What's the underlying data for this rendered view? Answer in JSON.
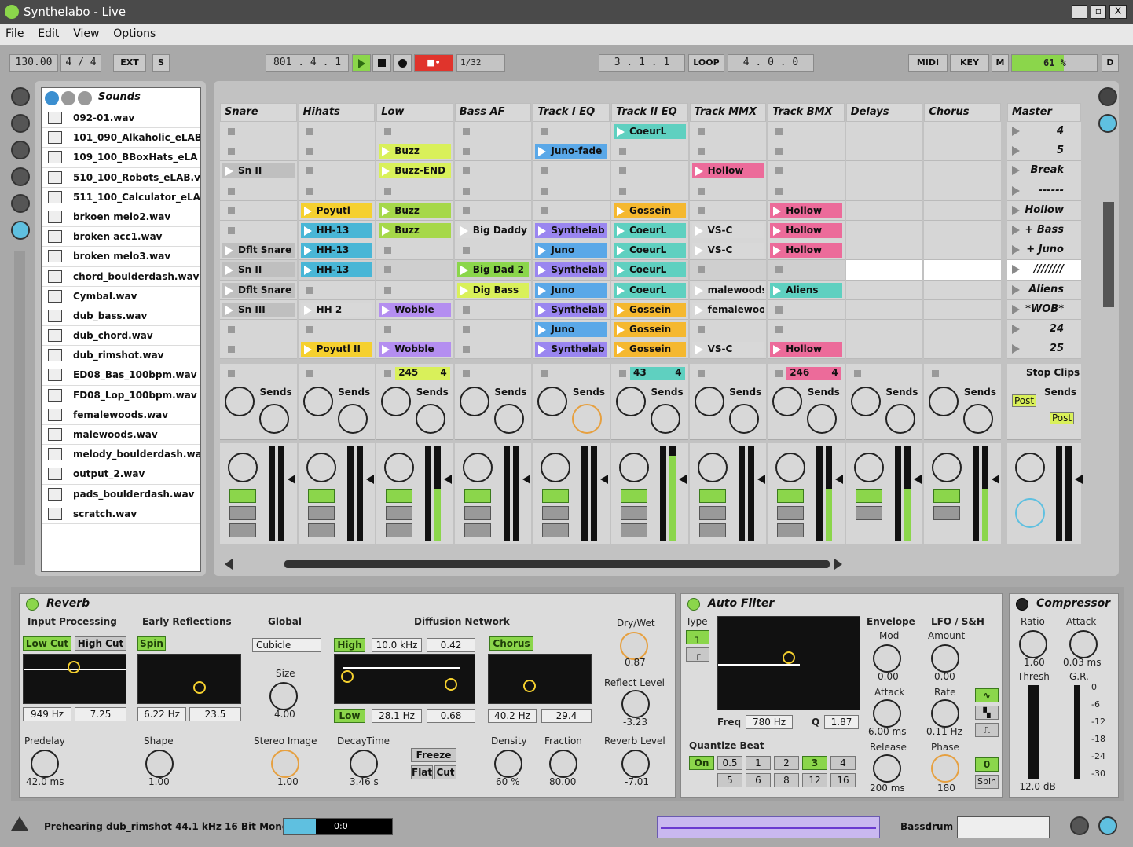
{
  "app": {
    "title": "Synthelabo - Live",
    "window_controls": [
      "_",
      "▫",
      "X"
    ]
  },
  "menu": [
    "File",
    "Edit",
    "View",
    "Options"
  ],
  "transport": {
    "tempo": "130.00",
    "signature": "4 / 4",
    "ext": "EXT",
    "s": "S",
    "position": "801 .  4 .  1",
    "quantize": "1/32",
    "loop_start": "3 .  1 .  1",
    "loop": "LOOP",
    "loop_length": "4 .  0 .  0",
    "midi": "MIDI",
    "key": "KEY",
    "m": "M",
    "cpu": "61 %",
    "d": "D"
  },
  "browser": {
    "tab": "Sounds",
    "files": [
      "092-01.wav",
      "101_090_Alkaholic_eLAB",
      "109_100_BBoxHats_eLA",
      "510_100_Robots_eLAB.v",
      "511_100_Calculator_eLA",
      "brkoen melo2.wav",
      "broken acc1.wav",
      "broken melo3.wav",
      "chord_boulderdash.wav",
      "Cymbal.wav",
      "dub_bass.wav",
      "dub_chord.wav",
      "dub_rimshot.wav",
      "ED08_Bas_100bpm.wav",
      "FD08_Lop_100bpm.wav",
      "femalewoods.wav",
      "malewoods.wav",
      "melody_boulderdash.wa",
      "output_2.wav",
      "pads_boulderdash.wav",
      "scratch.wav"
    ]
  },
  "tracks": [
    {
      "name": "Snare",
      "clips": [
        "",
        "",
        "Sn II",
        "",
        "",
        "",
        "Dflt Snare",
        "Sn II",
        "Dflt Snare",
        "Sn III",
        "",
        ""
      ],
      "colors": [
        "",
        "",
        "#bfbfbf",
        "",
        "",
        "",
        "#bfbfbf",
        "#bfbfbf",
        "#bfbfbf",
        "#bfbfbf",
        "",
        ""
      ]
    },
    {
      "name": "Hihats",
      "clips": [
        "",
        "",
        "",
        "",
        "Poyutl",
        "HH-13",
        "HH-13",
        "HH-13",
        "",
        "HH 2",
        "",
        "Poyutl II"
      ],
      "colors": [
        "",
        "",
        "",
        "",
        "#f5d02f",
        "#49b6d6",
        "#49b6d6",
        "#49b6d6",
        "",
        "#d8d8d8",
        "",
        "#f5d02f"
      ]
    },
    {
      "name": "Low",
      "clips": [
        "",
        "Buzz",
        "Buzz-END",
        "",
        "Buzz",
        "Buzz",
        "",
        "",
        "",
        "Wobble",
        "",
        "Wobble"
      ],
      "colors": [
        "",
        "#d9f05a",
        "#d9f05a",
        "",
        "#a6d84a",
        "#a6d84a",
        "",
        "",
        "",
        "#b48ef0",
        "",
        "#b48ef0"
      ]
    },
    {
      "name": "Bass AF",
      "clips": [
        "",
        "",
        "",
        "",
        "",
        "Big Daddy",
        "",
        "Big Dad 2",
        "Dig Bass",
        "",
        "",
        ""
      ],
      "colors": [
        "",
        "",
        "",
        "",
        "",
        "#d8d8d8",
        "",
        "#8bd64b",
        "#d9f05a",
        "",
        "",
        ""
      ]
    },
    {
      "name": "Track I EQ",
      "clips": [
        "",
        "Juno-fade",
        "",
        "",
        "",
        "Synthelab",
        "Juno",
        "Synthelab",
        "Juno",
        "Synthelab",
        "Juno",
        "Synthelab"
      ],
      "colors": [
        "",
        "#5aa8e8",
        "",
        "",
        "",
        "#9a86f0",
        "#5aa8e8",
        "#9a86f0",
        "#5aa8e8",
        "#9a86f0",
        "#5aa8e8",
        "#9a86f0"
      ]
    },
    {
      "name": "Track II EQ",
      "clips": [
        "CoeurL",
        "",
        "",
        "",
        "Gossein",
        "CoeurL",
        "CoeurL",
        "CoeurL",
        "CoeurL",
        "Gossein",
        "Gossein",
        "Gossein"
      ],
      "colors": [
        "#5fd0c0",
        "",
        "",
        "",
        "#f5b82f",
        "#5fd0c0",
        "#5fd0c0",
        "#5fd0c0",
        "#5fd0c0",
        "#f5b82f",
        "#f5b82f",
        "#f5b82f"
      ]
    },
    {
      "name": "Track MMX",
      "clips": [
        "",
        "",
        "Hollow",
        "",
        "",
        "VS-C",
        "VS-C",
        "",
        "malewoods",
        "femalewoo",
        "",
        "VS-C"
      ],
      "colors": [
        "",
        "",
        "#ec6b9a",
        "",
        "",
        "#d8d8d8",
        "#d8d8d8",
        "",
        "#d8d8d8",
        "#d8d8d8",
        "",
        "#d8d8d8"
      ]
    },
    {
      "name": "Track BMX",
      "clips": [
        "",
        "",
        "",
        "",
        "Hollow",
        "Hollow",
        "Hollow",
        "",
        "Aliens",
        "",
        "",
        "Hollow"
      ],
      "colors": [
        "",
        "",
        "",
        "",
        "#ec6b9a",
        "#ec6b9a",
        "#ec6b9a",
        "",
        "#5fd0c0",
        "",
        "",
        "#ec6b9a"
      ]
    },
    {
      "name": "Delays",
      "clips": [
        "",
        "",
        "",
        "",
        "",
        "",
        "",
        "",
        "",
        "",
        "",
        ""
      ],
      "colors": [
        "",
        "",
        "",
        "",
        "",
        "",
        "",
        "",
        "",
        "",
        "",
        ""
      ]
    },
    {
      "name": "Chorus",
      "clips": [
        "",
        "",
        "",
        "",
        "",
        "",
        "",
        "",
        "",
        "",
        "",
        ""
      ],
      "colors": [
        "",
        "",
        "",
        "",
        "",
        "",
        "",
        "",
        "",
        "",
        "",
        ""
      ]
    }
  ],
  "master": {
    "name": "Master",
    "scenes": [
      "4",
      "5",
      "Break",
      "------",
      "Hollow",
      "+ Bass",
      "+ Juno",
      "////////",
      "Aliens",
      "*WOB*",
      "24",
      "25"
    ],
    "stop_clips": "Stop Clips",
    "post": "Post"
  },
  "track_status": [
    {
      "text": "",
      "num": ""
    },
    {
      "text": "",
      "num": ""
    },
    {
      "text": "245",
      "num": "4"
    },
    {
      "text": "",
      "num": ""
    },
    {
      "text": "",
      "num": ""
    },
    {
      "text": "43",
      "num": "4"
    },
    {
      "text": "",
      "num": ""
    },
    {
      "text": "246",
      "num": "4"
    },
    {
      "text": "",
      "num": ""
    },
    {
      "text": "",
      "num": ""
    }
  ],
  "sends_label": "Sends",
  "knob_letters": {
    "d": "D",
    "c": "C"
  },
  "reverb": {
    "title": "Reverb",
    "input": {
      "label": "Input Processing",
      "low_cut": "Low Cut",
      "high_cut": "High Cut",
      "freq": "949 Hz",
      "q": "7.25",
      "predelay_label": "Predelay",
      "predelay": "42.0 ms"
    },
    "early": {
      "label": "Early Reflections",
      "spin": "Spin",
      "freq": "6.22 Hz",
      "amount": "23.5",
      "shape_label": "Shape",
      "shape": "1.00"
    },
    "global": {
      "label": "Global",
      "quality": "Cubicle",
      "size_label": "Size",
      "size": "4.00",
      "stereo_label": "Stereo Image",
      "stereo": "1.00"
    },
    "diffusion": {
      "label": "Diffusion Network",
      "high": "High",
      "high_freq": "10.0 kHz",
      "high_val": "0.42",
      "low": "Low",
      "low_freq": "28.1 Hz",
      "low_val": "0.68",
      "decay_label": "DecayTime",
      "decay": "3.46 s",
      "freeze": "Freeze",
      "flat": "Flat",
      "cut": "Cut",
      "chorus": "Chorus",
      "chorus_freq": "40.2 Hz",
      "chorus_val": "29.4",
      "density_label": "Density",
      "density": "60 %",
      "fraction_label": "Fraction",
      "fraction": "80.00"
    },
    "out": {
      "drywet_label": "Dry/Wet",
      "drywet": "0.87",
      "reflect_label": "Reflect Level",
      "reflect": "-3.23",
      "reverb_label": "Reverb Level",
      "reverb": "-7.01"
    }
  },
  "autofilter": {
    "title": "Auto Filter",
    "type_label": "Type",
    "freq_label": "Freq",
    "freq": "780 Hz",
    "q_label": "Q",
    "q": "1.87",
    "envelope": "Envelope",
    "mod_label": "Mod",
    "mod": "0.00",
    "attack_label": "Attack",
    "attack": "6.00 ms",
    "release_label": "Release",
    "release": "200 ms",
    "lfo": "LFO / S&H",
    "amount_label": "Amount",
    "amount": "0.00",
    "rate_label": "Rate",
    "rate": "0.11 Hz",
    "phase_label": "Phase",
    "phase": "180",
    "spin": "Spin",
    "zero": "0",
    "quantize_label": "Quantize Beat",
    "on": "On",
    "beats": [
      "0.5",
      "1",
      "2",
      "3",
      "4",
      "5",
      "6",
      "8",
      "12",
      "16"
    ]
  },
  "compressor": {
    "title": "Compressor",
    "ratio_label": "Ratio",
    "ratio": "1.60",
    "attack_label": "Attack",
    "attack": "0.03 ms",
    "thresh_label": "Thresh",
    "thresh": "-12.0 dB",
    "gr_label": "G.R.",
    "gr_scale": [
      "0",
      "-6",
      "-12",
      "-18",
      "-24",
      "-30"
    ]
  },
  "status": {
    "text": "Prehearing dub_rimshot 44.1 kHz 16 Bit Mono",
    "progress_label": "0:0",
    "progress": 0.3,
    "track": "Bassdrum"
  },
  "colors": {
    "accent_green": "#8bd64b",
    "panel": "#c2c2c2",
    "app_bg": "#a9a9a9"
  }
}
